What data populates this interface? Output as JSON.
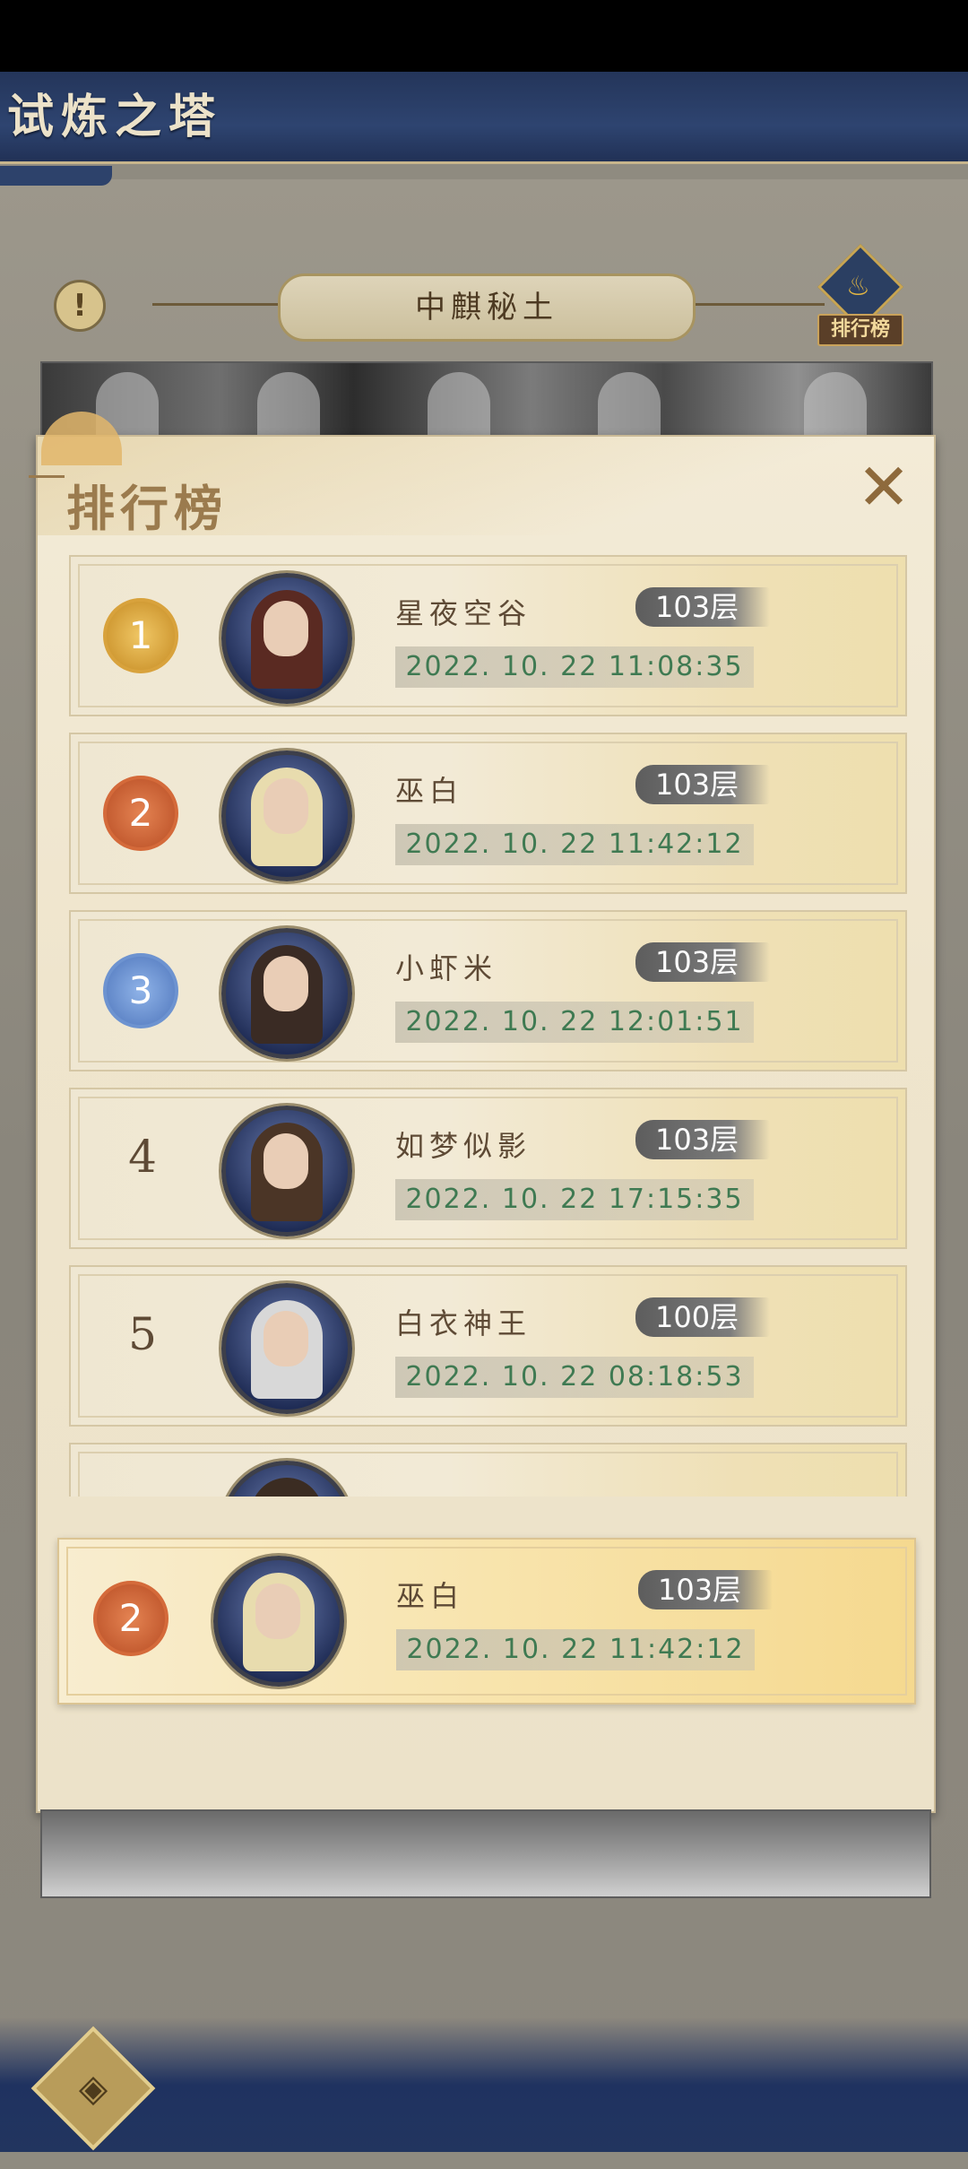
{
  "header": {
    "title": "试炼之塔"
  },
  "banner": {
    "stage_name": "中麒秘土",
    "rank_button_label": "排行榜",
    "info_icon": "!"
  },
  "leaderboard": {
    "title": "排行榜",
    "close_icon": "✕",
    "entries": [
      {
        "rank": "1",
        "medal": "gold",
        "name": "星夜空谷",
        "floor": "103层",
        "time": "2022. 10. 22  11:08:35"
      },
      {
        "rank": "2",
        "medal": "silver-red",
        "name": "巫白",
        "floor": "103层",
        "time": "2022. 10. 22  11:42:12"
      },
      {
        "rank": "3",
        "medal": "blue",
        "name": "小虾米",
        "floor": "103层",
        "time": "2022. 10. 22  12:01:51"
      },
      {
        "rank": "4",
        "medal": "none",
        "name": "如梦似影",
        "floor": "103层",
        "time": "2022. 10. 22  17:15:35"
      },
      {
        "rank": "5",
        "medal": "none",
        "name": "白衣神王",
        "floor": "100层",
        "time": "2022. 10. 22  08:18:53"
      }
    ],
    "my_entry": {
      "rank": "2",
      "medal": "silver-red",
      "name": "巫白",
      "floor": "103层",
      "time": "2022. 10. 22  11:42:12"
    }
  },
  "home_button_icon": "◈"
}
